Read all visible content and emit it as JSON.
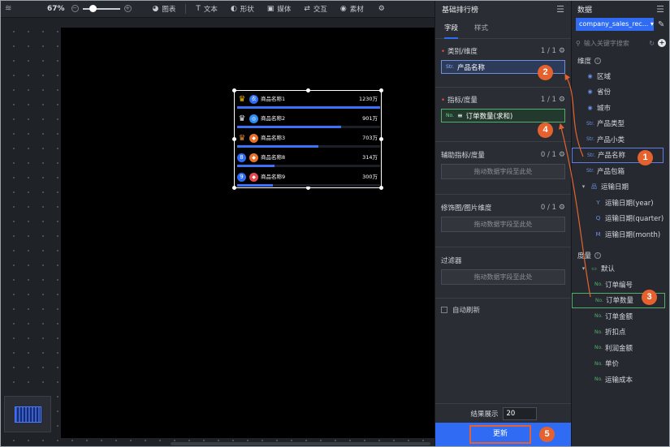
{
  "toolbar": {
    "zoom": "67%",
    "items": [
      {
        "icon": "pie-chart-icon",
        "label": "图表"
      },
      {
        "icon": "text-icon",
        "label": "文本"
      },
      {
        "icon": "shape-icon",
        "label": "形状"
      },
      {
        "icon": "image-icon",
        "label": "媒体"
      },
      {
        "icon": "interaction-icon",
        "label": "交互"
      },
      {
        "icon": "palette-icon",
        "label": "素材"
      }
    ]
  },
  "widget": {
    "rows": [
      {
        "rank": "crown-gold",
        "name": "商品名称1",
        "value": "1230万",
        "progress": 1.0,
        "badge_color": "#2f6cf3"
      },
      {
        "rank": "crown-silver",
        "name": "商品名称2",
        "value": "901万",
        "progress": 0.73,
        "badge_color": "#2f6cf3"
      },
      {
        "rank": "crown-bronze",
        "name": "商品名称3",
        "value": "703万",
        "progress": 0.57,
        "badge_color": "#e8702a"
      },
      {
        "rank": "8",
        "name": "商品名称8",
        "value": "314万",
        "progress": 0.26,
        "badge_color": "#e8702a"
      },
      {
        "rank": "9",
        "name": "商品名称9",
        "value": "300万",
        "progress": 0.25,
        "badge_color": "#e5484d"
      }
    ]
  },
  "config": {
    "title": "基础排行榜",
    "tabs": [
      "字段",
      "样式"
    ],
    "dimension": {
      "label": "类别/维度",
      "count": "1 / 1",
      "field": "产品名称",
      "field_type": "Str."
    },
    "measure": {
      "label": "指标/度量",
      "count": "1 / 1",
      "field": "订单数量(求和)",
      "field_type": "No."
    },
    "aux_measure": {
      "label": "辅助指标/度量",
      "count": "0 / 1",
      "placeholder": "拖动数据字段至此处"
    },
    "decor_dim": {
      "label": "修饰图/图片维度",
      "count": "0 / 1",
      "placeholder": "拖动数据字段至此处"
    },
    "filter": {
      "label": "过滤器",
      "placeholder": "拖动数据字段至此处"
    },
    "auto_refresh": "自动刷新",
    "result_label": "结果展示",
    "result_value": "20",
    "update_label": "更新"
  },
  "data_panel": {
    "title": "数据",
    "source": "company_sales_rec...",
    "search_placeholder": "输入关键字搜索",
    "dim_group": "维度",
    "dimensions": [
      {
        "label": "区域",
        "type": "geo"
      },
      {
        "label": "省份",
        "type": "geo"
      },
      {
        "label": "城市",
        "type": "geo"
      },
      {
        "label": "产品类型",
        "type": "str"
      },
      {
        "label": "产品小类",
        "type": "str"
      },
      {
        "label": "产品名称",
        "type": "str"
      },
      {
        "label": "产品包箱",
        "type": "str"
      },
      {
        "label": "运输日期",
        "type": "date"
      }
    ],
    "date_sub": [
      "运输日期(year)",
      "运输日期(quarter)",
      "运输日期(month)"
    ],
    "mea_group": "度量",
    "mea_folder": "默认",
    "measures": [
      "订单编号",
      "订单数量",
      "订单金额",
      "折扣点",
      "利润金额",
      "单价",
      "运输成本"
    ]
  },
  "callouts": [
    "1",
    "2",
    "3",
    "4",
    "5"
  ]
}
